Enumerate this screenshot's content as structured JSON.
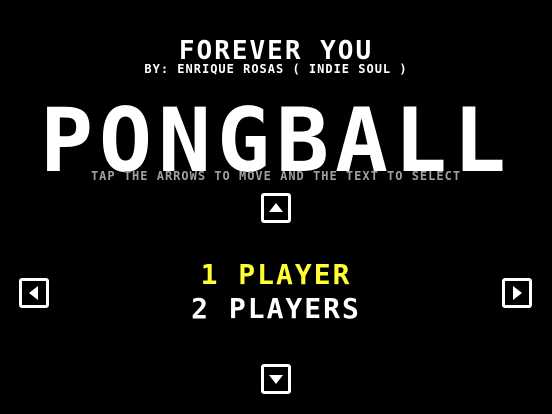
{
  "song": {
    "title": "FOREVER YOU",
    "artist": "BY: ENRIQUE ROSAS ( INDIE SOUL )"
  },
  "game": {
    "title": "PONGBALL"
  },
  "instructions": "TAP THE ARROWS TO MOVE AND THE TEXT TO SELECT",
  "menu": {
    "items": [
      {
        "label": "1 PLAYER",
        "selected": true
      },
      {
        "label": "2 PLAYERS",
        "selected": false
      }
    ]
  },
  "colors": {
    "background": "#000000",
    "text": "#ffffff",
    "selected": "#ffff33",
    "instructions": "#a0a0a0"
  },
  "icons": [
    "arrow-up-icon",
    "arrow-down-icon",
    "arrow-left-icon",
    "arrow-right-icon"
  ]
}
